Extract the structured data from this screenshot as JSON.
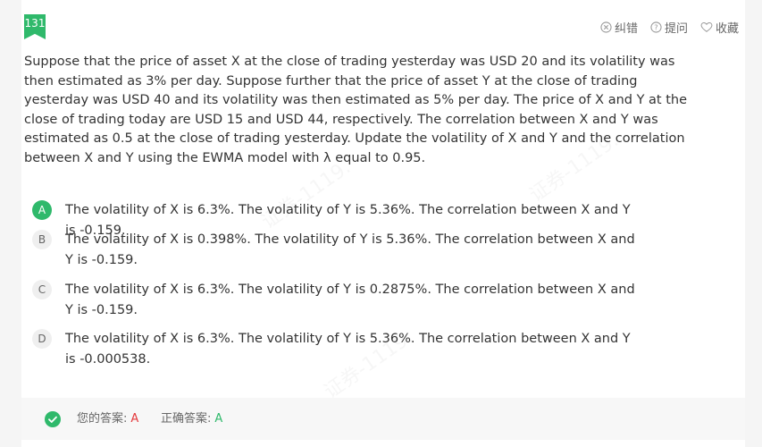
{
  "question": {
    "number": "131",
    "text": "Suppose that the price of asset X at the close of trading yesterday was USD 20 and its volatility was then estimated as 3% per day. Suppose further that the price of asset Y at the close of trading yesterday was USD 40 and its volatility was then estimated as 5% per day. The price of X and Y at the close of trading today are USD 15 and USD 44, respectively. The correlation between X and Y was estimated as 0.5 at the close of trading yesterday. Update the volatility of X and Y and the correlation between X and Y using the EWMA model with λ equal to 0.95."
  },
  "actions": {
    "report": "纠错",
    "ask": "提问",
    "favorite": "收藏"
  },
  "options": [
    {
      "letter": "A",
      "text": "The volatility of X is 6.3%. The volatility of Y is 5.36%. The correlation between X and Y is -0.159."
    },
    {
      "letter": "B",
      "text": "The volatility of X is 0.398%. The volatility of Y is 5.36%. The correlation between X and Y is -0.159."
    },
    {
      "letter": "C",
      "text": "The volatility of X is 6.3%. The volatility of Y is 0.2875%. The correlation between X and Y is -0.159."
    },
    {
      "letter": "D",
      "text": "The volatility of X is 6.3%. The volatility of Y is 5.36%. The correlation between X and Y is -0.000538."
    }
  ],
  "answer": {
    "your_label": "您的答案:",
    "your_value": "A",
    "correct_label": "正确答案:",
    "correct_value": "A"
  },
  "colors": {
    "accent": "#2fb96b",
    "your_answer": "#e4393c"
  }
}
